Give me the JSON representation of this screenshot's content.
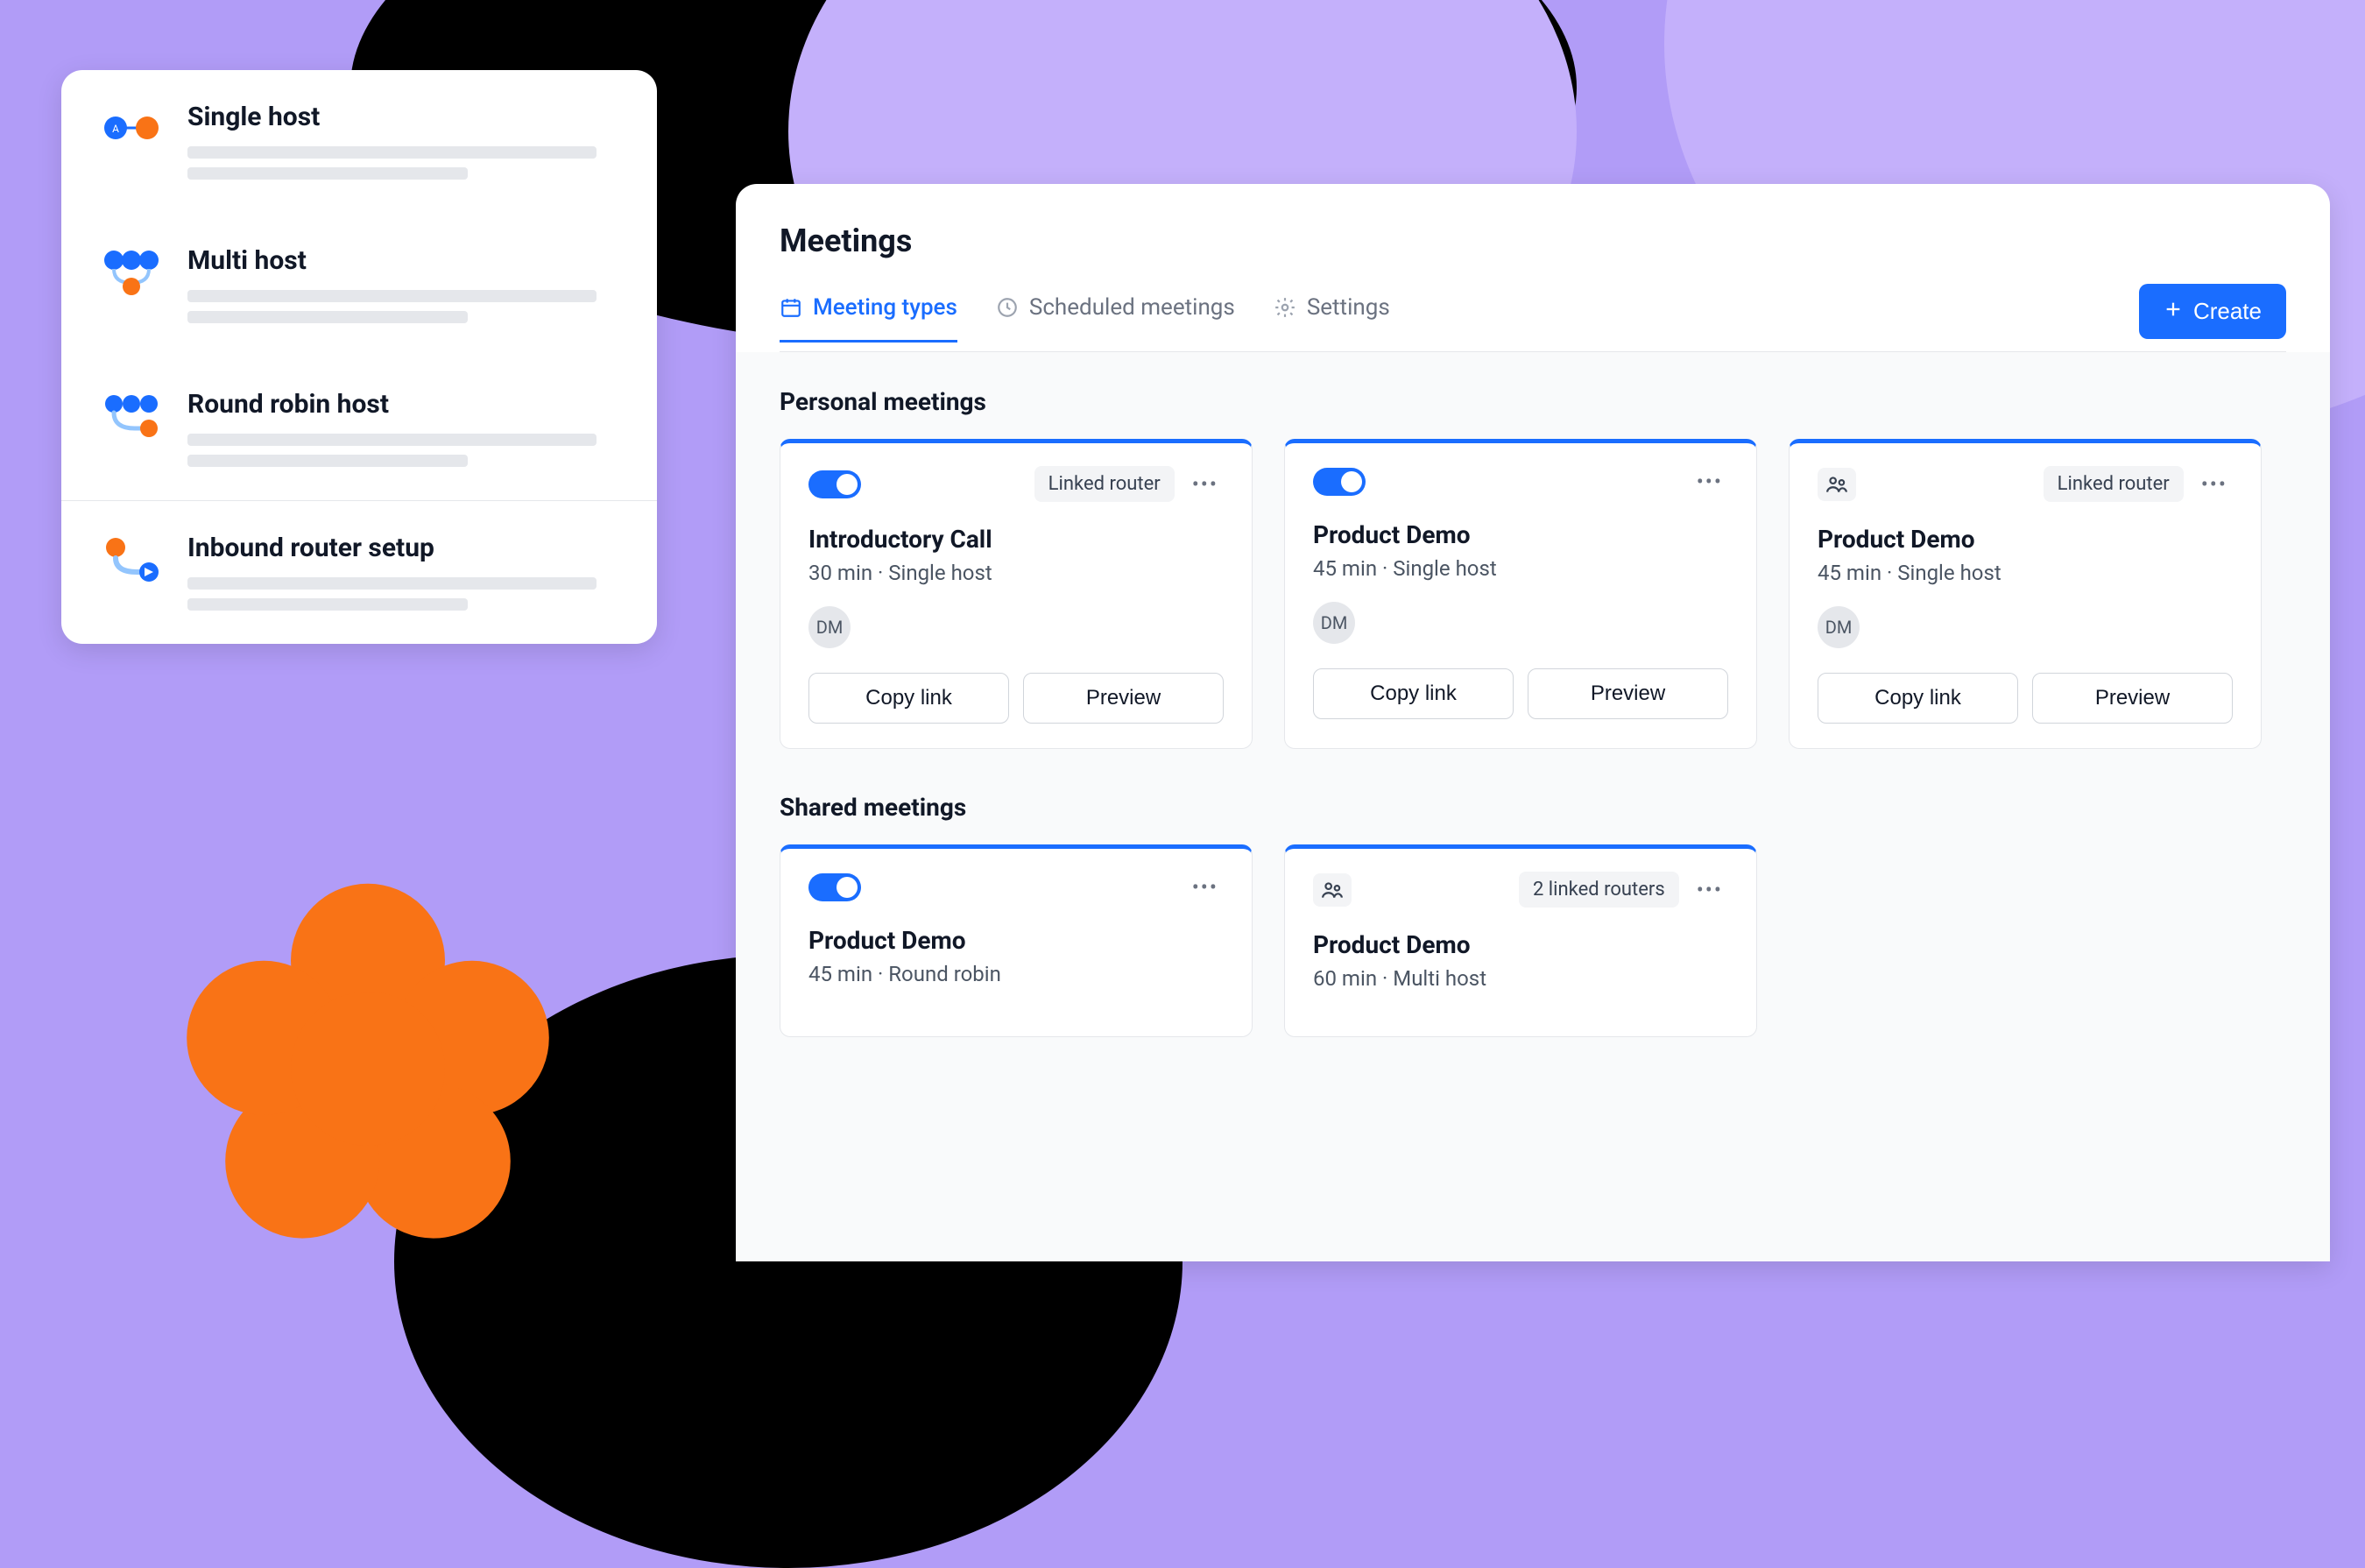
{
  "sidebar": {
    "items": [
      {
        "title": "Single host",
        "icon": "single-host-icon"
      },
      {
        "title": "Multi host",
        "icon": "multi-host-icon"
      },
      {
        "title": "Round robin host",
        "icon": "round-robin-icon"
      },
      {
        "title": "Inbound router setup",
        "icon": "inbound-router-icon"
      }
    ]
  },
  "main": {
    "title": "Meetings",
    "tabs": [
      {
        "label": "Meeting types",
        "icon": "calendar-icon",
        "active": true
      },
      {
        "label": "Scheduled meetings",
        "icon": "clock-icon",
        "active": false
      },
      {
        "label": "Settings",
        "icon": "gear-icon",
        "active": false
      }
    ],
    "create_label": "Create",
    "sections": [
      {
        "title": "Personal meetings",
        "cards": [
          {
            "toggle": true,
            "badge": "Linked router",
            "show_more": true,
            "title": "Introductory Call",
            "sub": "30 min · Single host",
            "avatar": "DM",
            "copy_label": "Copy link",
            "preview_label": "Preview"
          },
          {
            "toggle": true,
            "badge": null,
            "show_more": true,
            "title": "Product Demo",
            "sub": "45 min · Single host",
            "avatar": "DM",
            "copy_label": "Copy link",
            "preview_label": "Preview"
          },
          {
            "toggle": false,
            "type_icon": "multi-user-icon",
            "badge": "Linked router",
            "show_more": true,
            "title": "Product Demo",
            "sub": "45 min · Single host",
            "avatar": "DM",
            "copy_label": "Copy link",
            "preview_label": "Preview"
          }
        ]
      },
      {
        "title": "Shared meetings",
        "cards": [
          {
            "toggle": true,
            "badge": null,
            "show_more": true,
            "title": "Product Demo",
            "sub": "45 min · Round robin",
            "avatar": null
          },
          {
            "toggle": false,
            "type_icon": "multi-user-icon",
            "badge": "2 linked routers",
            "show_more": true,
            "title": "Product Demo",
            "sub": "60 min · Multi host",
            "avatar": null
          }
        ]
      }
    ]
  },
  "colors": {
    "accent": "#1a6dff",
    "orange": "#f97316",
    "purple": "#b19cf7"
  }
}
